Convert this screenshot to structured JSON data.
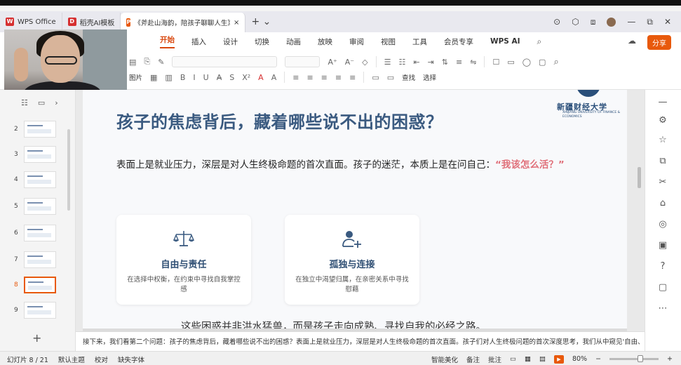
{
  "tabs": [
    {
      "label": "WPS Office",
      "logo_color": "#d63031",
      "logo": "W"
    },
    {
      "label": "稻壳AI模板",
      "logo_color": "#d63031",
      "logo": "D"
    },
    {
      "label": "《斧赴山海韵，陪孩子聊聊人生》",
      "logo_color": "#e8590c",
      "logo": "P",
      "close": "×"
    }
  ],
  "tab_plus": "+ ⌄",
  "window_controls": [
    "⊙",
    "⬡",
    "⧈",
    "—",
    "⧉",
    "✕"
  ],
  "menu": {
    "items": [
      "开始",
      "插入",
      "设计",
      "切换",
      "动画",
      "放映",
      "审阅",
      "视图",
      "工具",
      "会员专享",
      "WPS AI"
    ],
    "active_index": 0,
    "share_label": "分享",
    "dropdown": "⌄"
  },
  "toolbar": {
    "image_label": "图片",
    "row1": [
      "A⁺",
      "A⁻",
      "◇",
      "☰",
      "☷",
      "⇤",
      "⇥",
      "⇅",
      "≡",
      "⇋",
      "☐",
      "▭",
      "◯",
      "▢"
    ],
    "row2": [
      "B",
      "I",
      "U",
      "A̶",
      "S",
      "X²",
      "A",
      "A",
      "≡",
      "≡",
      "≡",
      "≡",
      "≡",
      "▭",
      "▭"
    ],
    "right_labels": [
      "查找",
      "选择"
    ]
  },
  "left_panel": {
    "slides": [
      {
        "num": "2"
      },
      {
        "num": "3"
      },
      {
        "num": "4"
      },
      {
        "num": "5"
      },
      {
        "num": "6"
      },
      {
        "num": "7"
      },
      {
        "num": "8"
      },
      {
        "num": "9"
      }
    ],
    "active": "8",
    "add": "+"
  },
  "slide": {
    "title": "孩子的焦虑背后，藏着哪些说不出的困惑？",
    "para_before": "表面上是就业压力，深层是对人生终极命题的首次直面。孩子的迷茫，本质上是在问自己：",
    "para_highlight": "“我该怎么活？”",
    "logo_cn": "新疆财经大学",
    "logo_en": "XINJIANG UNIVERSITY OF FINANCE & ECONOMICS",
    "cards": [
      {
        "title": "自由与责任",
        "desc": "在选择中权衡，在约束中寻找自我掌控感",
        "icon": "scales-icon"
      },
      {
        "title": "孤独与连接",
        "desc": "在独立中渴望归属，在亲密关系中寻找慰藉",
        "icon": "user-add-icon"
      }
    ],
    "bottom_text": "这些困惑并非洪水猛兽，而是孩子走向成熟、寻找自我的必经之路。"
  },
  "notes": "接下来，我们看第二个问题：孩子的焦虑背后，藏着哪些说不出的困惑？表面上是就业压力，深层是对人生终极命题的首次直面。孩子们对人生终极问题的首次深度思考，我们从中窥见'自由、责任、孤独'的主题。",
  "status": {
    "slide_info": "幻灯片 8 / 21",
    "theme": "默认主题",
    "proof": "校对",
    "font_missing": "缺失字体",
    "beautify": "智能美化",
    "notes_label": "备注",
    "comment": "批注",
    "zoom": "80%"
  },
  "colors": {
    "accent": "#e8590c",
    "title": "#3a5a80",
    "highlight": "#e0707a"
  }
}
